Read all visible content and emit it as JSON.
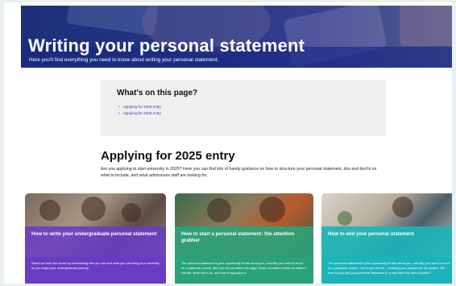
{
  "hero": {
    "title": "Writing your personal statement",
    "subtitle": "Here you'll find everything you need to know about writing your personal statement."
  },
  "toc": {
    "title": "What's on this page?",
    "links": [
      "Applying for 2025 entry",
      "Applying for 2026 entry"
    ]
  },
  "section": {
    "title": "Applying for 2025 entry",
    "intro": "Are you applying to start university in 2025? Here you can find lots of handy guidance on how to structure your personal statement, dos and don'ts on what to include, and what admissions staff are looking for."
  },
  "cards": [
    {
      "title": "How to write your undergraduate personal statement",
      "body": "Stand out from the crowd by showcasing who you are and what you can bring to a university as you begin your undergraduate journey."
    },
    {
      "title": "How to start a personal statement: the attention grabber",
      "body": "The personal statement is your opportunity to talk about you, and why you want to enrol on a particular course. But how do you start it strongly? Read our advice below on what to include, what not to do, and how to approach it."
    },
    {
      "title": "How to end your personal statement",
      "body": "The personal statement is your opportunity to talk about you, and why you want to enrol on a particular course. You've got this far – showing your passion for the subject. But how do you end your personal statement in a way that truly does it justice?"
    }
  ],
  "colors": {
    "hero": "#25378a",
    "link": "#2b3ea6",
    "card_purple": "#6a3cc4",
    "card_green": "#2aa37a",
    "card_teal": "#1bb3b9"
  }
}
